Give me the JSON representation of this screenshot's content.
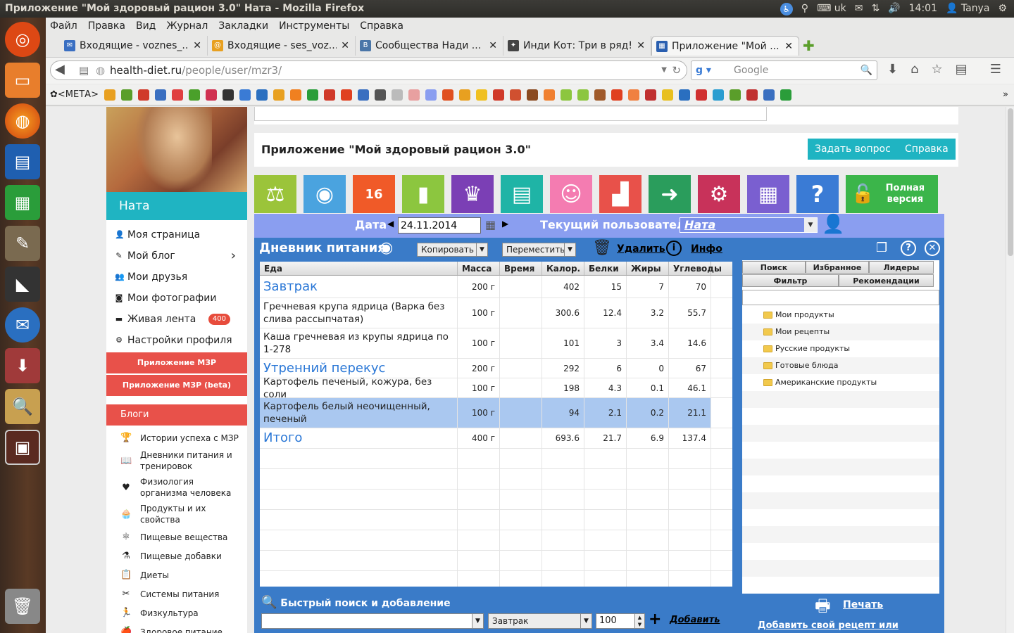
{
  "system": {
    "window_title": "Приложение \"Мой здоровый рацион 3.0\" Ната - Mozilla Firefox",
    "keyboard_layout": "uk",
    "time": "14:01",
    "user": "Tanya"
  },
  "firefox": {
    "menu": [
      "Файл",
      "Правка",
      "Вид",
      "Журнал",
      "Закладки",
      "Инструменты",
      "Справка"
    ],
    "tabs": [
      {
        "title": "Входящие - voznes_...",
        "fav_color": "#3a6fc2",
        "fav": "✉",
        "active": false
      },
      {
        "title": "Входящие - ses_voz...",
        "fav_color": "#e8a020",
        "fav": "@",
        "active": false
      },
      {
        "title": "Сообщества Нади ...",
        "fav_color": "#4a76a8",
        "fav": "B",
        "active": false
      },
      {
        "title": "Инди Кот: Три в ряд!",
        "fav_color": "#444444",
        "fav": "✦",
        "active": false
      },
      {
        "title": "Приложение \"Мой ...",
        "fav_color": "#2a5fb0",
        "fav": "▦",
        "active": true
      }
    ],
    "url_host": "health-diet.ru",
    "url_path": "/people/user/mzr3/",
    "search_placeholder": "Google",
    "bookmark_first": "<МЕТА>"
  },
  "sidebar": {
    "username": "Ната",
    "menu": [
      {
        "label": "Моя страница",
        "icon": "user-icon",
        "glyph": "👤"
      },
      {
        "label": "Мой блог",
        "icon": "edit-icon",
        "glyph": "✎"
      },
      {
        "label": "Мои друзья",
        "icon": "friends-icon",
        "glyph": "👥"
      },
      {
        "label": "Мои фотографии",
        "icon": "camera-icon",
        "glyph": "◙"
      },
      {
        "label": "Живая лента",
        "icon": "feed-icon",
        "glyph": "▬",
        "badge": "400"
      },
      {
        "label": "Настройки профиля",
        "icon": "gear-icon",
        "glyph": "⚙"
      }
    ],
    "app_button": "Приложение МЗР",
    "app_beta_button": "Приложение МЗР (beta)",
    "blogs_header": "Блоги",
    "blogs": [
      {
        "label": "Истории успеха с МЗР",
        "icon": "trophy-icon",
        "glyph": "🏆"
      },
      {
        "label": "Дневники питания и тренировок",
        "icon": "book-icon",
        "glyph": "📖"
      },
      {
        "label": "Физиология организма человека",
        "icon": "heart-icon",
        "glyph": "♥"
      },
      {
        "label": "Продукты и их свойства",
        "icon": "cake-icon",
        "glyph": "🧁"
      },
      {
        "label": "Пищевые вещества",
        "icon": "atom-icon",
        "glyph": "⚛"
      },
      {
        "label": "Пищевые добавки",
        "icon": "flask-icon",
        "glyph": "⚗"
      },
      {
        "label": "Диеты",
        "icon": "clipboard-icon",
        "glyph": "📋"
      },
      {
        "label": "Системы питания",
        "icon": "cutlery-icon",
        "glyph": "✂"
      },
      {
        "label": "Физкультура",
        "icon": "runner-icon",
        "glyph": "🏃"
      },
      {
        "label": "Здоровое питание",
        "icon": "apple-icon",
        "glyph": "🍎"
      }
    ]
  },
  "app": {
    "title": "Приложение \"Мой здоровый рацион 3.0\"",
    "ask_button": "Задать вопрос",
    "help_button": "Справка",
    "tiles": [
      {
        "name": "scale-tile",
        "color": "#9bc43a",
        "glyph": "⚖"
      },
      {
        "name": "plate-tile",
        "color": "#4aa3df",
        "glyph": "◉"
      },
      {
        "name": "kettlebell-tile",
        "color": "#f05a28",
        "glyph": "16"
      },
      {
        "name": "chart-tile",
        "color": "#8cc63f",
        "glyph": "▮"
      },
      {
        "name": "chef-tile",
        "color": "#7b3fb5",
        "glyph": "♛"
      },
      {
        "name": "oven-tile",
        "color": "#1fb4a6",
        "glyph": "▤"
      },
      {
        "name": "woman-tile",
        "color": "#f47cb1",
        "glyph": "☺"
      },
      {
        "name": "podium-tile",
        "color": "#e8514a",
        "glyph": "▟"
      },
      {
        "name": "arrow-tile",
        "color": "#2a9d5c",
        "glyph": "➜"
      },
      {
        "name": "gear-tile",
        "color": "#c8325a",
        "glyph": "⚙"
      },
      {
        "name": "calculator-tile",
        "color": "#7a5fd0",
        "glyph": "▦"
      },
      {
        "name": "question-tile",
        "color": "#3a7bd5",
        "glyph": "?"
      }
    ],
    "full_version": "Полная версия",
    "date_label": "Дата",
    "date_value": "24.11.2014",
    "current_user_label": "Текущий пользователь",
    "current_user_value": "Ната",
    "diary_title": "Дневник питания",
    "copy_button": "Копировать",
    "move_button": "Переместить",
    "delete_button": "Удалить",
    "info_button": "Инфо",
    "columns": [
      "Еда",
      "Масса",
      "Время",
      "Калор.",
      "Белки",
      "Жиры",
      "Углеводы"
    ],
    "rows": [
      {
        "food": "Завтрак",
        "mass": "200 г",
        "time": "",
        "cal": "402",
        "prot": "15",
        "fat": "7",
        "carb": "70",
        "meal": true,
        "h": 32
      },
      {
        "food": "Гречневая крупа ядрица (Варка без слива рассыпчатая)",
        "mass": "100 г",
        "time": "",
        "cal": "300.6",
        "prot": "12.4",
        "fat": "3.2",
        "carb": "55.7",
        "meal": false,
        "h": 43
      },
      {
        "food": "Каша гречневая из крупы ядрица по 1-278",
        "mass": "100 г",
        "time": "",
        "cal": "101",
        "prot": "3",
        "fat": "3.4",
        "carb": "14.6",
        "meal": false,
        "h": 43
      },
      {
        "food": "Утренний перекус",
        "mass": "200 г",
        "time": "",
        "cal": "292",
        "prot": "6",
        "fat": "0",
        "carb": "67",
        "meal": true,
        "h": 28
      },
      {
        "food": "Картофель печеный, кожура, без соли",
        "mass": "100 г",
        "time": "",
        "cal": "198",
        "prot": "4.3",
        "fat": "0.1",
        "carb": "46.1",
        "meal": false,
        "h": 28
      },
      {
        "food": "Картофель белый неочищенный, печеный",
        "mass": "100 г",
        "time": "",
        "cal": "94",
        "prot": "2.1",
        "fat": "0.2",
        "carb": "21.1",
        "meal": false,
        "sel": true,
        "h": 43
      },
      {
        "food": "Итого",
        "mass": "400 г",
        "time": "",
        "cal": "693.6",
        "prot": "21.7",
        "fat": "6.9",
        "carb": "137.4",
        "meal": true,
        "h": 29
      }
    ],
    "search_tabs": [
      "Поиск",
      "Избранное",
      "Лидеры"
    ],
    "search_tabs2": [
      "Фильтр",
      "Рекомендации"
    ],
    "tree": [
      "Мои продукты",
      "Мои рецепты",
      "Русские продукты",
      "Готовые блюда",
      "Американские продукты"
    ],
    "quick_search": "Быстрый поиск и добавление",
    "meal_select": "Завтрак",
    "amount": "100",
    "add_button": "Добавить",
    "print_link": "Печать",
    "add_recipe_link": "Добавить свой рецепт или продукт"
  }
}
